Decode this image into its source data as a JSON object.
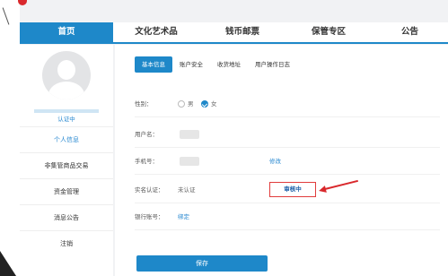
{
  "nav": {
    "items": [
      "首页",
      "文化艺术品",
      "钱币邮票",
      "保管专区",
      "公告"
    ]
  },
  "sidebar": {
    "auth_status": "认证中",
    "items": [
      "个人信息",
      "非集管商品交易",
      "资金管理",
      "消息公告",
      "注销"
    ]
  },
  "main": {
    "tabs": [
      "基本信息",
      "账户安全",
      "收货地址",
      "用户操作日志"
    ],
    "gender": {
      "label": "性别：",
      "options": [
        "男",
        "女"
      ],
      "selected": "女"
    },
    "username": {
      "label": "用户名："
    },
    "phone": {
      "label": "手机号：",
      "link": "修改"
    },
    "realname": {
      "label": "实名认证：",
      "status": "未认证",
      "review": "审核中"
    },
    "bank": {
      "label": "银行账号：",
      "link": "绑定"
    },
    "save_label": "保存"
  }
}
